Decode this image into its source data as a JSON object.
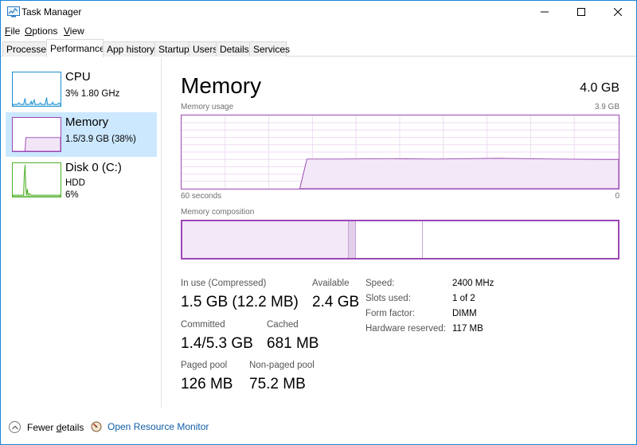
{
  "window": {
    "title": "Task Manager"
  },
  "menu": {
    "file": "ile",
    "file_accel": "F",
    "options": "ptions",
    "options_accel": "O",
    "view": "iew",
    "view_accel": "V"
  },
  "tabs": [
    "Processes",
    "Performance",
    "App history",
    "Startup",
    "Users",
    "Details",
    "Services"
  ],
  "sidebar": {
    "cpu": {
      "title": "CPU",
      "sub": "3%  1.80 GHz"
    },
    "memory": {
      "title": "Memory",
      "sub": "1.5/3.9 GB (38%)"
    },
    "disk": {
      "title": "Disk 0 (C:)",
      "sub1": "HDD",
      "sub2": "6%"
    }
  },
  "main": {
    "title": "Memory",
    "total": "4.0 GB",
    "usage_label": "Memory usage",
    "usage_max": "3.9 GB",
    "time_left": "60 seconds",
    "time_right": "0",
    "composition_label": "Memory composition"
  },
  "stats": {
    "in_use_label": "In use (Compressed)",
    "in_use_value": "1.5 GB (12.2 MB)",
    "available_label": "Available",
    "available_value": "2.4 GB",
    "committed_label": "Committed",
    "committed_value": "1.4/5.3 GB",
    "cached_label": "Cached",
    "cached_value": "681 MB",
    "paged_label": "Paged pool",
    "paged_value": "126 MB",
    "nonpaged_label": "Non-paged pool",
    "nonpaged_value": "75.2 MB"
  },
  "info": {
    "speed_label": "Speed:",
    "speed_value": "2400 MHz",
    "slots_label": "Slots used:",
    "slots_value": "1 of 2",
    "form_label": "Form factor:",
    "form_value": "DIMM",
    "reserved_label": "Hardware reserved:",
    "reserved_value": "117 MB"
  },
  "footer": {
    "fewer_details": "Fewer details",
    "fewer_accel": "d",
    "open_resmon": "Open Resource Monitor"
  },
  "colors": {
    "accent_memory": "#9b47b4",
    "cpu": "#1a8fd0",
    "disk": "#4caf26",
    "selected": "#cce8ff"
  }
}
